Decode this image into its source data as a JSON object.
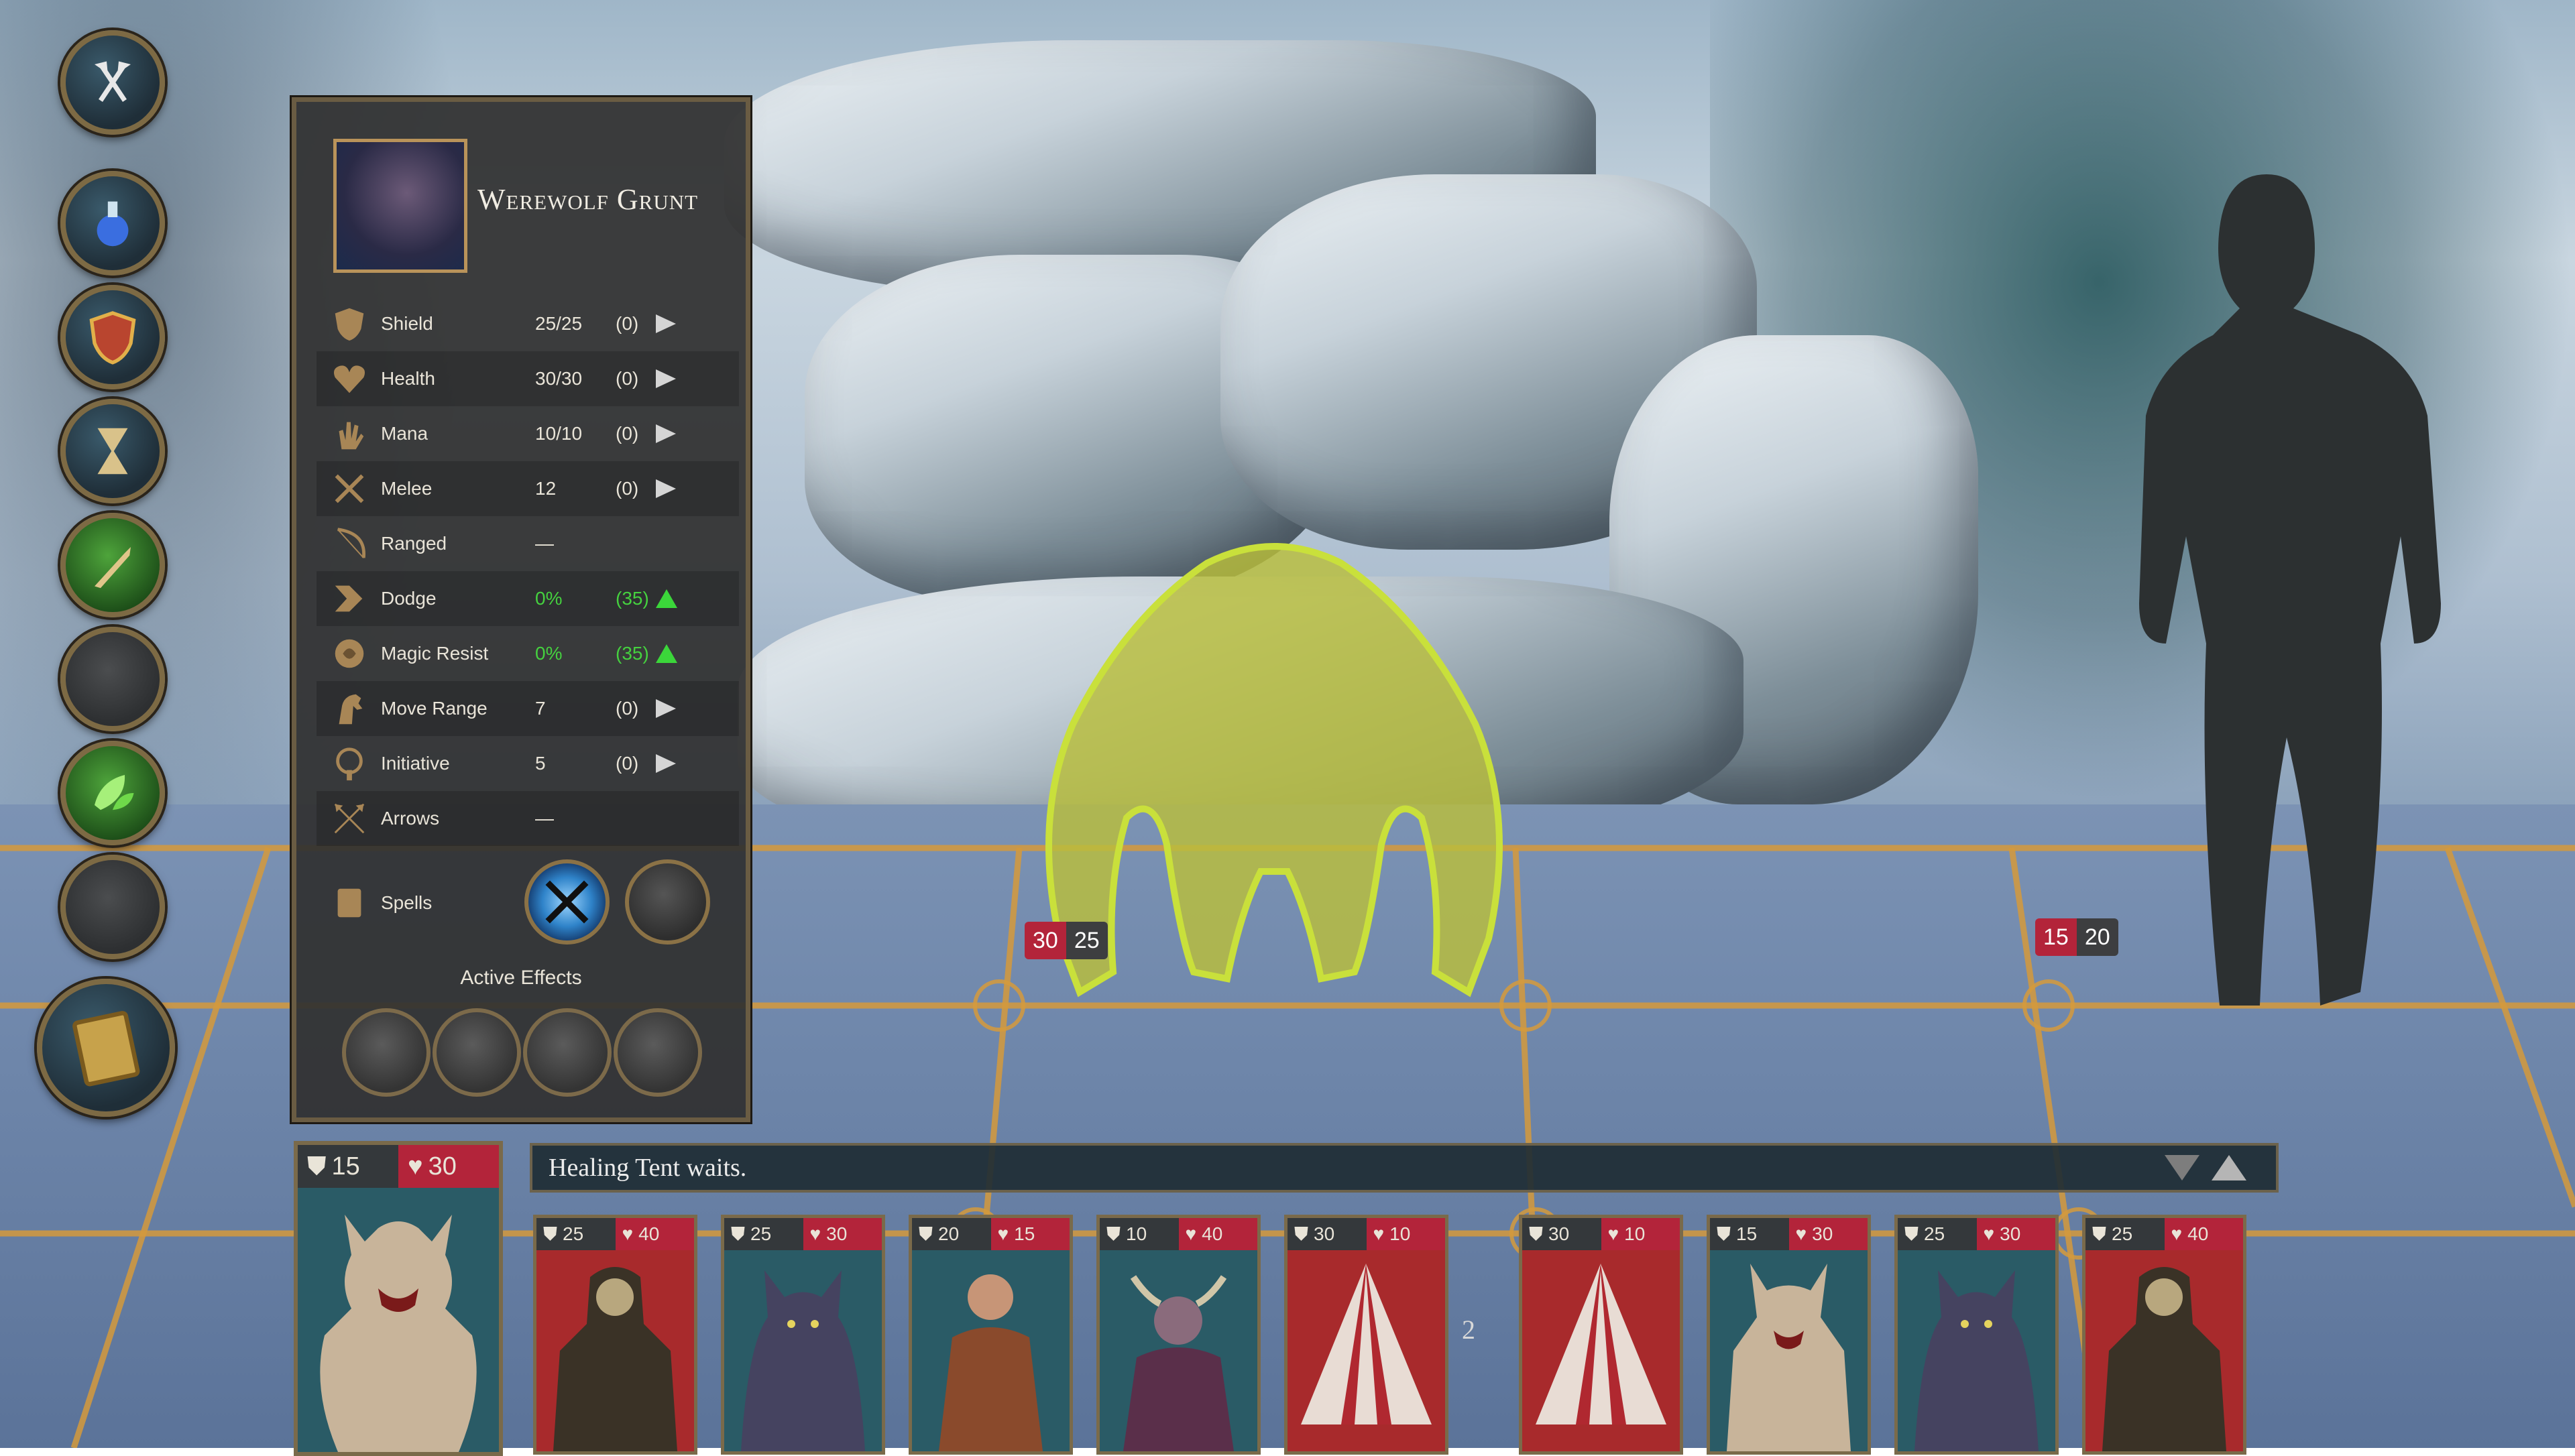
{
  "unit": {
    "name": "Werewolf Grunt",
    "stats": [
      {
        "label": "Shield",
        "value": "25/25",
        "mod": "(0)",
        "icon": "shield-icon",
        "trend": "neutral"
      },
      {
        "label": "Health",
        "value": "30/30",
        "mod": "(0)",
        "icon": "heart-icon",
        "trend": "neutral"
      },
      {
        "label": "Mana",
        "value": "10/10",
        "mod": "(0)",
        "icon": "mana-hand-icon",
        "trend": "neutral"
      },
      {
        "label": "Melee",
        "value": "12",
        "mod": "(0)",
        "icon": "crossed-swords-icon",
        "trend": "neutral"
      },
      {
        "label": "Ranged",
        "value": "—",
        "mod": "",
        "icon": "bow-icon",
        "trend": "none"
      },
      {
        "label": "Dodge",
        "value": "0%",
        "mod": "(35)",
        "icon": "dodge-icon",
        "trend": "up"
      },
      {
        "label": "Magic Resist",
        "value": "0%",
        "mod": "(35)",
        "icon": "magic-resist-icon",
        "trend": "up"
      },
      {
        "label": "Move Range",
        "value": "7",
        "mod": "(0)",
        "icon": "horse-icon",
        "trend": "neutral"
      },
      {
        "label": "Initiative",
        "value": "5",
        "mod": "(0)",
        "icon": "initiative-icon",
        "trend": "neutral"
      },
      {
        "label": "Arrows",
        "value": "—",
        "mod": "",
        "icon": "arrows-icon",
        "trend": "none"
      }
    ],
    "spells_label": "Spells",
    "active_effects_label": "Active Effects"
  },
  "field_units": [
    {
      "name": "werewolf",
      "health": "30",
      "shield": "25"
    },
    {
      "name": "elf-archer",
      "health": "15",
      "shield": "20"
    }
  ],
  "log": {
    "message": "Healing Tent waits."
  },
  "current_unit": {
    "shield": "15",
    "health": "30"
  },
  "queue": [
    {
      "shield": "25",
      "health": "40",
      "art": "skeleton-warrior",
      "bg": "#a82a2c"
    },
    {
      "shield": "25",
      "health": "30",
      "art": "werewolf",
      "bg": "#2a5b66"
    },
    {
      "shield": "20",
      "health": "15",
      "art": "elf-archer",
      "bg": "#2a5b66"
    },
    {
      "shield": "10",
      "health": "40",
      "art": "horned-warrior",
      "bg": "#2a5b66"
    },
    {
      "shield": "30",
      "health": "10",
      "art": "healing-tent",
      "bg": "#a82a2c"
    },
    {
      "shield": "30",
      "health": "10",
      "art": "healing-tent",
      "bg": "#a82a2c"
    },
    {
      "shield": "15",
      "health": "30",
      "art": "ghoul",
      "bg": "#2a5b66"
    },
    {
      "shield": "25",
      "health": "30",
      "art": "werewolf",
      "bg": "#2a5b66"
    },
    {
      "shield": "25",
      "health": "40",
      "art": "skeleton-warrior",
      "bg": "#a82a2c"
    }
  ],
  "round_number": "2",
  "colors": {
    "accent_gold": "#d59a3c",
    "health_red": "#b3243a",
    "buff_green": "#45d13f"
  }
}
